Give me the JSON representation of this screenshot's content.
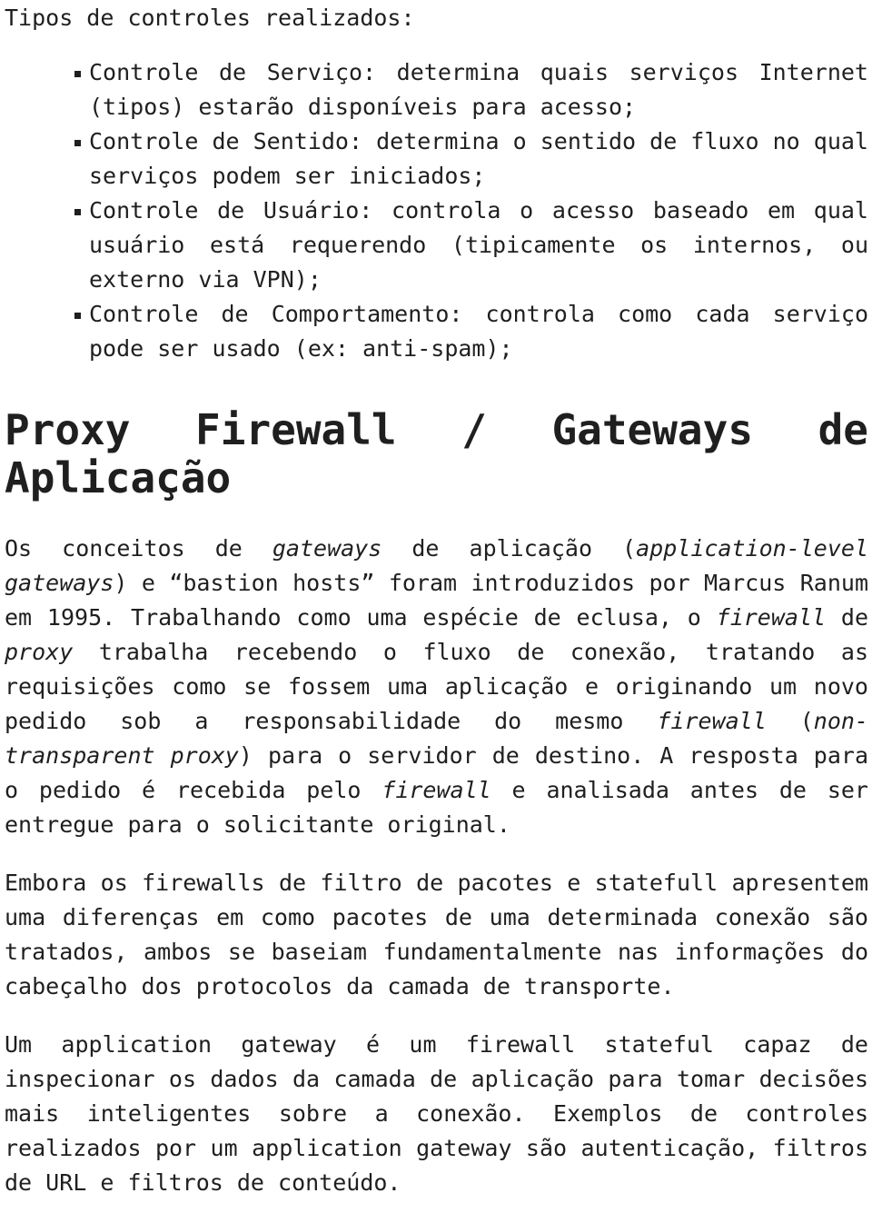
{
  "document": {
    "text_color": "#1f1f1f",
    "background_color": "#ffffff",
    "intro_line": "Tipos de controles realizados:",
    "bullets": [
      "Controle de Serviço: determina quais serviços Internet (tipos) estarão disponíveis para acesso;",
      "Controle de Sentido: determina o sentido de fluxo no qual serviços podem ser iniciados;",
      "Controle de Usuário: controla o acesso baseado em qual usuário está requerendo (tipicamente os internos, ou externo via VPN);",
      "Controle de Comportamento: controla como cada serviço pode ser usado (ex: anti-spam);"
    ],
    "bullet_glyph": "square-bullet",
    "section_title": "Proxy Firewall / Gateways de Aplicação",
    "paragraphs": [
      {
        "id": "paragraph-gateways-intro",
        "runs": [
          {
            "style": "normal",
            "text": "Os conceitos de "
          },
          {
            "style": "italic",
            "text": "gateways"
          },
          {
            "style": "normal",
            "text": " de aplicação ("
          },
          {
            "style": "italic",
            "text": "application-level gateways"
          },
          {
            "style": "normal",
            "text": ") e “bastion hosts” foram introduzidos por Marcus Ranum em 1995. Trabalhando como uma espécie de eclusa, o "
          },
          {
            "style": "italic",
            "text": "firewall"
          },
          {
            "style": "normal",
            "text": " de "
          },
          {
            "style": "italic",
            "text": "proxy"
          },
          {
            "style": "normal",
            "text": " trabalha recebendo o fluxo de conexão, tratando as requisições como se fossem uma aplicação e originando um novo pedido sob a responsabilidade do mesmo "
          },
          {
            "style": "italic",
            "text": "firewall"
          },
          {
            "style": "normal",
            "text": " ("
          },
          {
            "style": "italic",
            "text": "non-transparent proxy"
          },
          {
            "style": "normal",
            "text": ") para o servidor de destino. A resposta para o pedido é recebida pelo "
          },
          {
            "style": "italic",
            "text": "firewall"
          },
          {
            "style": "normal",
            "text": " e analisada antes de ser entregue para o solicitante original."
          }
        ]
      },
      {
        "id": "paragraph-packet-filter-comparison",
        "runs": [
          {
            "style": "normal",
            "text": "Embora os firewalls de filtro de pacotes e statefull apresentem uma diferenças em como pacotes de uma determinada conexão são tratados, ambos se baseiam fundamentalmente nas informações do cabeçalho dos protocolos da camada de transporte."
          }
        ]
      },
      {
        "id": "paragraph-application-gateway-definition",
        "runs": [
          {
            "style": "normal",
            "text": "Um application gateway é um firewall stateful capaz de inspecionar os dados da camada de aplicação para tomar decisões mais inteligentes sobre a conexão. Exemplos de controles realizados por um application gateway são autenticação, filtros de URL e filtros de conteúdo."
          }
        ]
      }
    ]
  }
}
